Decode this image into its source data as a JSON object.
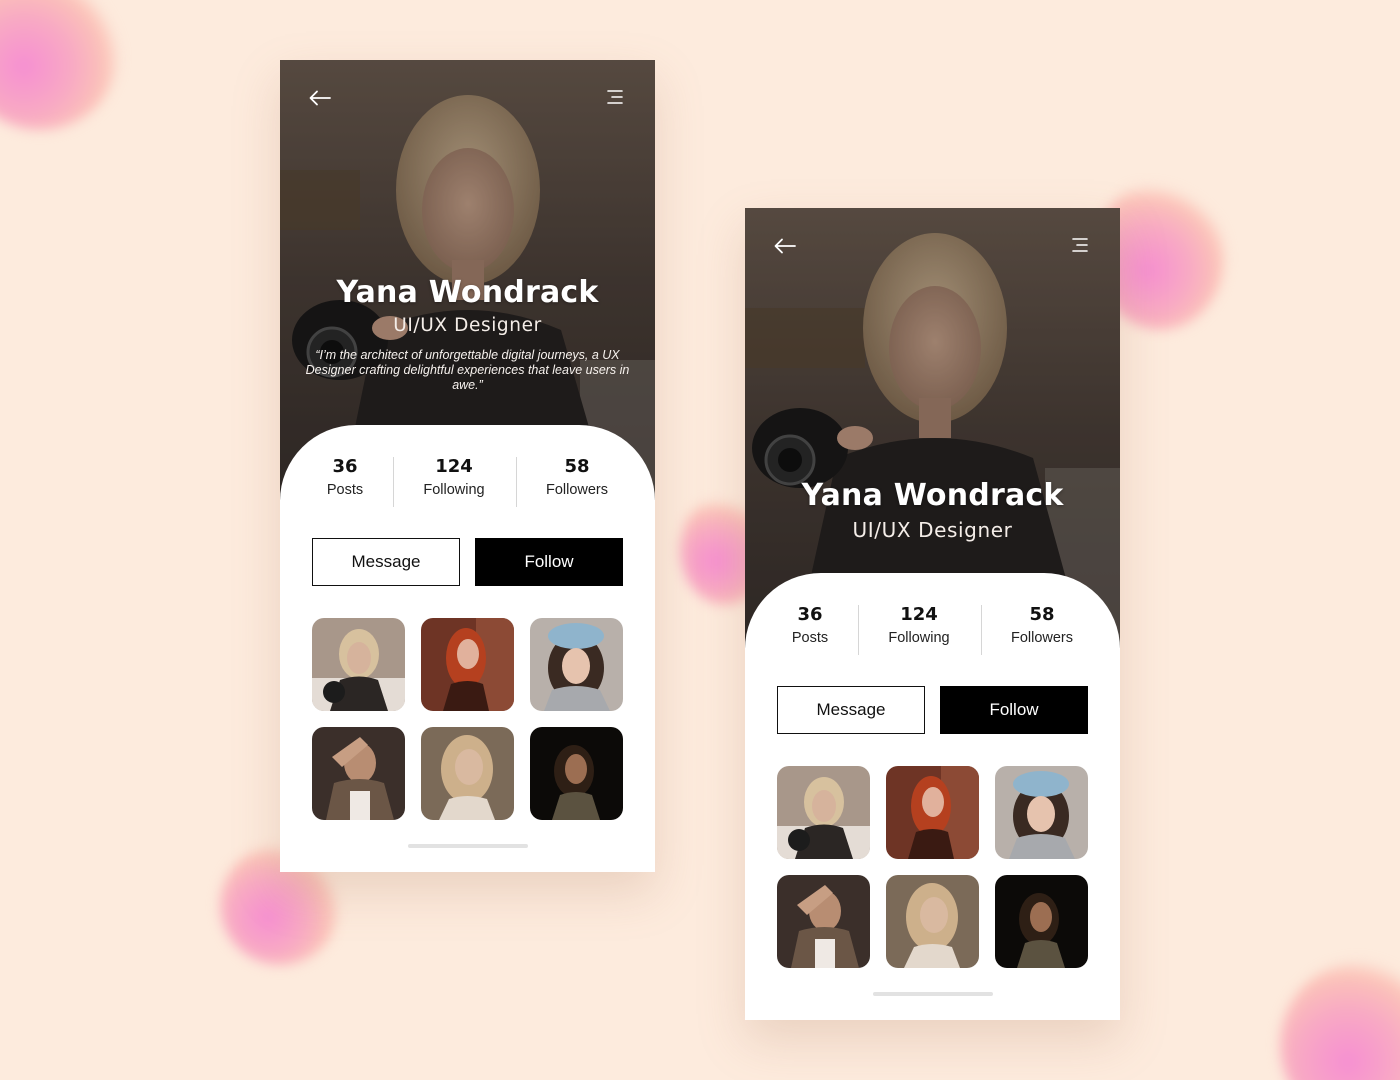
{
  "colors": {
    "background": "#fdebdd",
    "accent_black": "#000000",
    "blob_pink": "#f68fd2"
  },
  "screens": [
    {
      "header": {
        "back_icon": "arrow-left-icon",
        "menu_icon": "menu-icon"
      },
      "profile": {
        "name": "Yana Wondrack",
        "role": "UI/UX Designer",
        "quote": "“I’m the architect of unforgettable digital journeys, a UX Designer crafting delightful experiences that leave users in awe.”"
      },
      "stats": [
        {
          "value": "36",
          "label": "Posts"
        },
        {
          "value": "124",
          "label": "Following"
        },
        {
          "value": "58",
          "label": "Followers"
        }
      ],
      "actions": {
        "message": "Message",
        "follow": "Follow"
      }
    },
    {
      "header": {
        "back_icon": "arrow-left-icon",
        "menu_icon": "menu-icon"
      },
      "profile": {
        "name": "Yana Wondrack",
        "role": "UI/UX Designer"
      },
      "stats": [
        {
          "value": "36",
          "label": "Posts"
        },
        {
          "value": "124",
          "label": "Following"
        },
        {
          "value": "58",
          "label": "Followers"
        }
      ],
      "actions": {
        "message": "Message",
        "follow": "Follow"
      }
    }
  ],
  "gallery_thumbnails": [
    "photo-woman-camera",
    "photo-woman-red-hair",
    "photo-woman-blue-hat",
    "photo-woman-shadow",
    "photo-woman-smiling",
    "photo-woman-dark"
  ]
}
